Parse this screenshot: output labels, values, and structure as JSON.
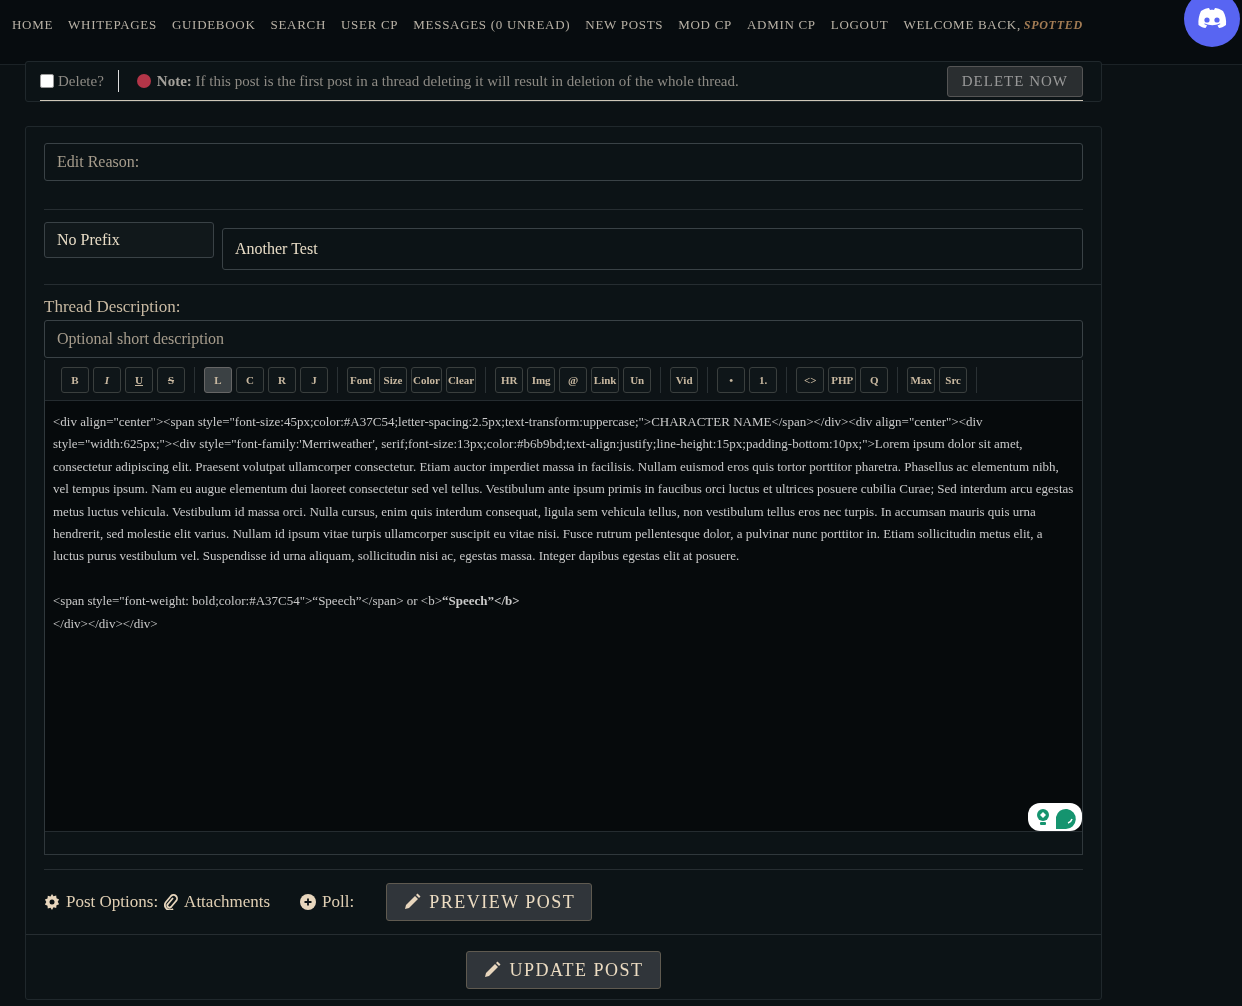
{
  "nav": {
    "links": [
      "HOME",
      "WHITEPAGES",
      "GUIDEBOOK",
      "SEARCH",
      "USER CP",
      "MESSAGES (0 UNREAD)",
      "NEW POSTS",
      "MOD CP",
      "ADMIN CP",
      "LOGOUT"
    ],
    "welcome": "WELCOME BACK,",
    "user": "SPOTTED"
  },
  "delete_row": {
    "checkbox_label": "Delete?",
    "checked": false,
    "note_label": "Note:",
    "note": "If this post is the first post in a thread deleting it will result in deletion of the whole thread.",
    "button": "DELETE NOW"
  },
  "form": {
    "edit_reason": {
      "placeholder": "Edit Reason:"
    },
    "prefix": "No Prefix",
    "subject": "Another Test",
    "description_label": "Thread Description:",
    "description": {
      "placeholder": "Optional short description"
    },
    "toolbar": [
      [
        {
          "label": "B",
          "kind": "bold",
          "selected": false
        },
        {
          "label": "I",
          "kind": "italic",
          "selected": false
        },
        {
          "label": "U",
          "kind": "underline",
          "selected": false
        },
        {
          "label": "S",
          "kind": "strike",
          "selected": false
        }
      ],
      [
        {
          "label": "L",
          "kind": "plain",
          "selected": true
        },
        {
          "label": "C",
          "kind": "plain",
          "selected": false
        },
        {
          "label": "R",
          "kind": "plain",
          "selected": false
        },
        {
          "label": "J",
          "kind": "plain",
          "selected": false
        }
      ],
      [
        {
          "label": "Font",
          "kind": "plain",
          "selected": false
        },
        {
          "label": "Size",
          "kind": "plain",
          "selected": false
        },
        {
          "label": "Color",
          "kind": "plain",
          "selected": false
        },
        {
          "label": "Clear",
          "kind": "plain",
          "selected": false
        }
      ],
      [
        {
          "label": "HR",
          "kind": "plain",
          "selected": false
        },
        {
          "label": "Img",
          "kind": "plain",
          "selected": false
        },
        {
          "label": "@",
          "kind": "plain",
          "selected": false
        },
        {
          "label": "Link",
          "kind": "plain",
          "selected": false
        },
        {
          "label": "Un",
          "kind": "plain",
          "selected": false
        }
      ],
      [
        {
          "label": "Vid",
          "kind": "plain",
          "selected": false
        }
      ],
      [
        {
          "label": "•",
          "kind": "plain",
          "selected": false
        },
        {
          "label": "1.",
          "kind": "plain",
          "selected": false
        }
      ],
      [
        {
          "label": "<>",
          "kind": "plain",
          "selected": false
        },
        {
          "label": "PHP",
          "kind": "plain",
          "selected": false
        },
        {
          "label": "Q",
          "kind": "plain",
          "selected": false
        }
      ],
      [
        {
          "label": "Max",
          "kind": "plain",
          "selected": false
        },
        {
          "label": "Src",
          "kind": "plain",
          "selected": false
        }
      ]
    ],
    "content": "<div align=\"center\"><span style=\"font-size:45px;color:#A37C54;letter-spacing:2.5px;text-transform:uppercase;\">CHARACTER NAME</span></div><div align=\"center\"><div style=\"width:625px;\"><div style=\"font-family:'Merriweather', serif;font-size:13px;color:#b6b9bd;text-align:justify;line-height:15px;padding-bottom:10px;\">Lorem ipsum dolor sit amet, consectetur adipiscing elit. Praesent volutpat ullamcorper consectetur. Etiam auctor imperdiet massa in facilisis. Nullam euismod eros quis tortor porttitor pharetra. Phasellus ac elementum nibh, vel tempus ipsum. Nam eu augue elementum dui laoreet consectetur sed vel tellus. Vestibulum ante ipsum primis in faucibus orci luctus et ultrices posuere cubilia Curae; Sed interdum arcu egestas metus luctus vehicula. Vestibulum id massa orci. Nulla cursus, enim quis interdum consequat, ligula sem vehicula tellus, non vestibulum tellus eros nec turpis. In accumsan mauris quis urna hendrerit, sed molestie elit varius. Nullam id ipsum vitae turpis ullamcorper suscipit eu vitae nisi. Fusce rutrum pellentesque dolor, a pulvinar nunc porttitor in. Etiam sollicitudin metus elit, a luctus purus vestibulum vel. Suspendisse id urna aliquam, sollicitudin nisi ac, egestas massa. Integer dapibus egestas elit at posuere.\n\n<span style=\"font-weight: bold;color:#A37C54\">“Speech”</span> or <b>**“Speech”</b>**\n</div></div></div>",
    "post_options_label": "Post Options:",
    "attachments": "Attachments",
    "poll": "Poll:",
    "preview_button": "PREVIEW POST",
    "update_button": "UPDATE POST"
  }
}
